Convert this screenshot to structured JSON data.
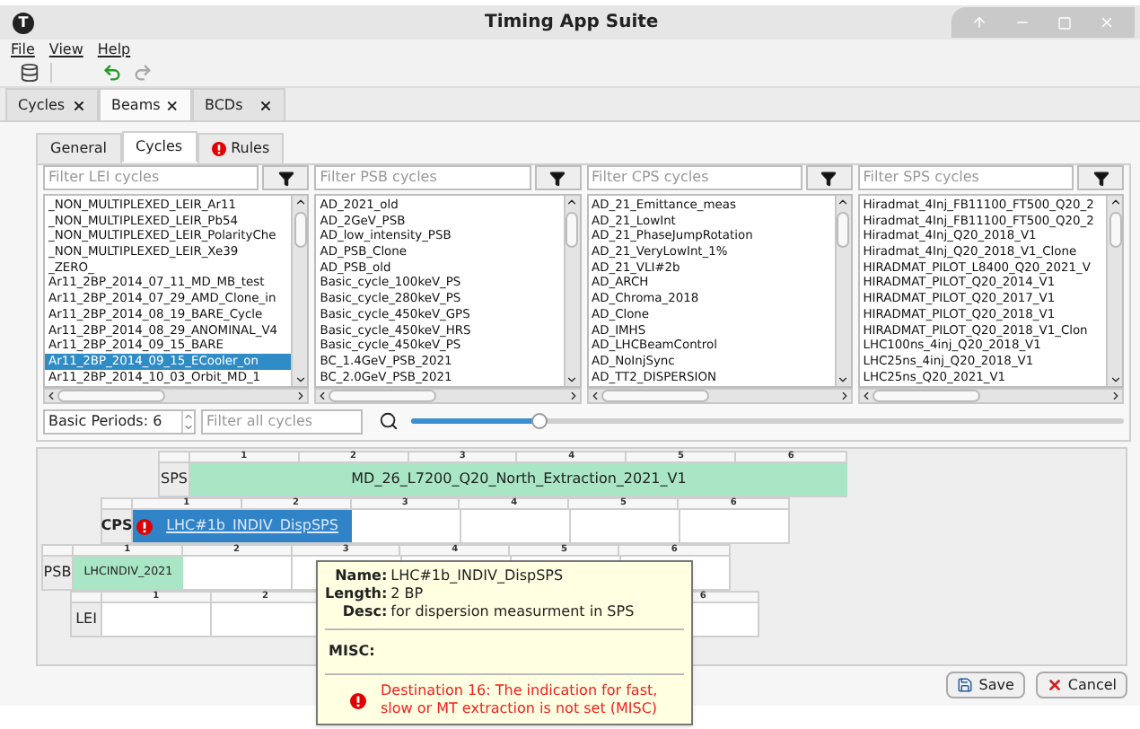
{
  "window": {
    "title": "Timing App Suite",
    "logo_letter": "T"
  },
  "menu": [
    "File",
    "View",
    "Help"
  ],
  "toolbar": [
    {
      "kind": "database",
      "disabled": false
    },
    {
      "kind": "undo",
      "disabled": false
    },
    {
      "kind": "redo",
      "disabled": true
    }
  ],
  "outer_tabs": [
    {
      "label": "Cycles",
      "selected": false
    },
    {
      "label": "Beams",
      "selected": true
    },
    {
      "label": "BCDs",
      "selected": false
    }
  ],
  "inner_tabs": [
    {
      "label": "General",
      "selected": false,
      "warning": false
    },
    {
      "label": "Cycles",
      "selected": true,
      "warning": false
    },
    {
      "label": "Rules",
      "selected": false,
      "warning": true
    }
  ],
  "lists": [
    {
      "placeholder": "Filter LEI cycles",
      "items": [
        {
          "label": "_NON_MULTIPLEXED_LEIR_Ar11",
          "selected": false
        },
        {
          "label": "_NON_MULTIPLEXED_LEIR_Pb54",
          "selected": false
        },
        {
          "label": "_NON_MULTIPLEXED_LEIR_PolarityChe",
          "selected": false
        },
        {
          "label": "_NON_MULTIPLEXED_LEIR_Xe39",
          "selected": false
        },
        {
          "label": "_ZERO_",
          "selected": false
        },
        {
          "label": "Ar11_2BP_2014_07_11_MD_MB_test",
          "selected": false
        },
        {
          "label": "Ar11_2BP_2014_07_29_AMD_Clone_in",
          "selected": false
        },
        {
          "label": "Ar11_2BP_2014_08_19_BARE_Cycle",
          "selected": false
        },
        {
          "label": "Ar11_2BP_2014_08_29_ANOMINAL_V4",
          "selected": false
        },
        {
          "label": "Ar11_2BP_2014_09_15_BARE",
          "selected": false
        },
        {
          "label": "Ar11_2BP_2014_09_15_ECooler_on",
          "selected": true
        },
        {
          "label": "Ar11_2BP_2014_10_03_Orbit_MD_1",
          "selected": false
        }
      ]
    },
    {
      "placeholder": "Filter PSB cycles",
      "items": [
        {
          "label": "AD_2021_old",
          "selected": false
        },
        {
          "label": "AD_2GeV_PSB",
          "selected": false
        },
        {
          "label": "AD_low_intensity_PSB",
          "selected": false
        },
        {
          "label": "AD_PSB_Clone",
          "selected": false
        },
        {
          "label": "AD_PSB_old",
          "selected": false
        },
        {
          "label": "Basic_cycle_100keV_PS",
          "selected": false
        },
        {
          "label": "Basic_cycle_280keV_PS",
          "selected": false
        },
        {
          "label": "Basic_cycle_450keV_GPS",
          "selected": false
        },
        {
          "label": "Basic_cycle_450keV_HRS",
          "selected": false
        },
        {
          "label": "Basic_cycle_450keV_PS",
          "selected": false
        },
        {
          "label": "BC_1.4GeV_PSB_2021",
          "selected": false
        },
        {
          "label": "BC_2.0GeV_PSB_2021",
          "selected": false
        }
      ]
    },
    {
      "placeholder": "Filter CPS cycles",
      "items": [
        {
          "label": "AD_21_Emittance_meas",
          "selected": false
        },
        {
          "label": "AD_21_LowInt",
          "selected": false
        },
        {
          "label": "AD_21_PhaseJumpRotation",
          "selected": false
        },
        {
          "label": "AD_21_VeryLowInt_1%",
          "selected": false
        },
        {
          "label": "AD_21_VLI#2b",
          "selected": false
        },
        {
          "label": "AD_ARCH",
          "selected": false
        },
        {
          "label": "AD_Chroma_2018",
          "selected": false
        },
        {
          "label": "AD_Clone",
          "selected": false
        },
        {
          "label": "AD_IMHS",
          "selected": false
        },
        {
          "label": "AD_LHCBeamControl",
          "selected": false
        },
        {
          "label": "AD_NoInjSync",
          "selected": false
        },
        {
          "label": "AD_TT2_DISPERSION",
          "selected": false
        }
      ]
    },
    {
      "placeholder": "Filter SPS cycles",
      "items": [
        {
          "label": "Hiradmat_4Inj_FB11100_FT500_Q20_2",
          "selected": false
        },
        {
          "label": "Hiradmat_4Inj_FB11100_FT500_Q20_2",
          "selected": false
        },
        {
          "label": "Hiradmat_4Inj_Q20_2018_V1",
          "selected": false
        },
        {
          "label": "Hiradmat_4Inj_Q20_2018_V1_Clone",
          "selected": false
        },
        {
          "label": "HIRADMAT_PILOT_L8400_Q20_2021_V",
          "selected": false
        },
        {
          "label": "HIRADMAT_PILOT_Q20_2014_V1",
          "selected": false
        },
        {
          "label": "HIRADMAT_PILOT_Q20_2017_V1",
          "selected": false
        },
        {
          "label": "HIRADMAT_PILOT_Q20_2018_V1",
          "selected": false
        },
        {
          "label": "HIRADMAT_PILOT_Q20_2018_V1_Clon",
          "selected": false
        },
        {
          "label": "LHC100ns_4inj_Q20_2018_V1",
          "selected": false
        },
        {
          "label": "LHC25ns_4inj_Q20_2018_V1",
          "selected": false
        },
        {
          "label": "LHC25ns_Q20_2021_V1",
          "selected": false
        }
      ]
    }
  ],
  "controls": {
    "basic_periods": "Basic Periods: 6",
    "filter_placeholder": "Filter all cycles",
    "zoom": {
      "level": 0.18
    }
  },
  "timeline": [
    {
      "label": "SPS",
      "bold": false,
      "warning": false,
      "ticks": [
        {
          "label": "1"
        },
        {
          "label": "2"
        },
        {
          "label": "3"
        },
        {
          "label": "4"
        },
        {
          "label": "5"
        },
        {
          "label": "6"
        }
      ],
      "cycle": {
        "name": "MD_26_L7200_Q20_North_Extraction_2021_V1",
        "selected": false
      }
    },
    {
      "label": "CPS",
      "bold": true,
      "warning": true,
      "ticks": [
        {
          "label": "1"
        },
        {
          "label": "2"
        },
        {
          "label": "3"
        },
        {
          "label": "4"
        },
        {
          "label": "5"
        },
        {
          "label": "6"
        }
      ],
      "cycle": {
        "name": "LHC#1b_INDIV_DispSPS",
        "selected": true
      }
    },
    {
      "label": "PSB",
      "bold": false,
      "warning": false,
      "ticks": [
        {
          "label": "1"
        },
        {
          "label": "2"
        },
        {
          "label": "3"
        },
        {
          "label": "4"
        },
        {
          "label": "5"
        },
        {
          "label": "6"
        }
      ],
      "cycle": {
        "name": "LHCINDIV_2021",
        "selected": false
      }
    },
    {
      "label": "LEI",
      "bold": false,
      "warning": false,
      "ticks": [
        {
          "label": "1"
        },
        {
          "label": "2"
        },
        {
          "label": "6"
        }
      ]
    }
  ],
  "tooltip": {
    "fields": [
      {
        "label": "Name:",
        "value": "LHC#1b_INDIV_DispSPS"
      },
      {
        "label": "Length:",
        "value": "2 BP"
      },
      {
        "label": "Desc:",
        "value": "for dispersion measurment in SPS"
      }
    ],
    "misc_label": "MISC:",
    "error": "Destination 16: The indication for fast, slow or MT extraction is not set (MISC)"
  },
  "buttons": [
    {
      "label": "Save",
      "kind": "save"
    },
    {
      "label": "Cancel",
      "kind": "cancel"
    }
  ]
}
